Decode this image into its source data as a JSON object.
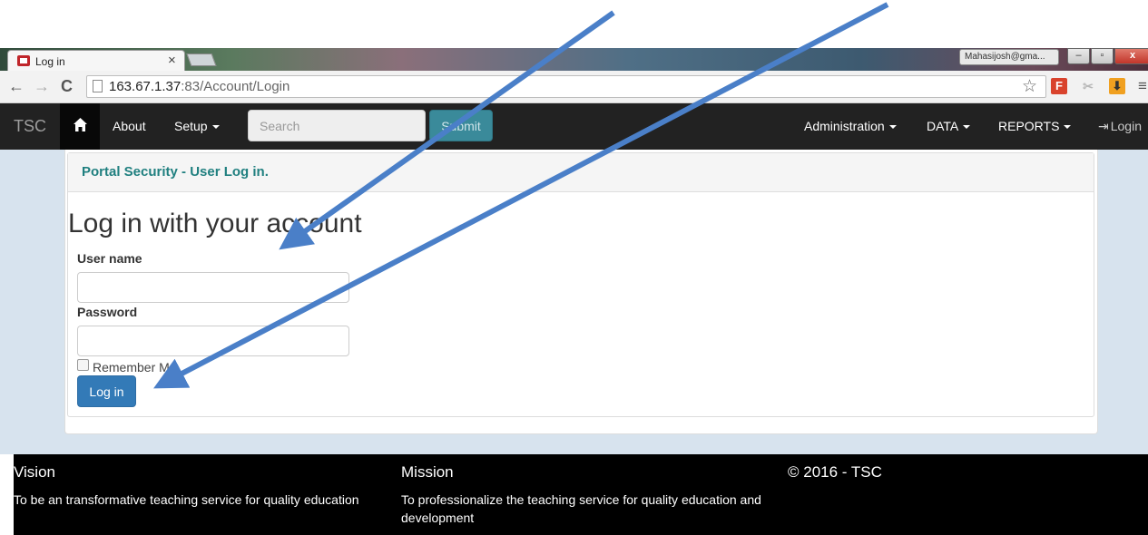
{
  "browser": {
    "tab_title": "Log in",
    "tab_close": "×",
    "url_host": "163.67.1.37",
    "url_path": ":83/Account/Login",
    "profile": "Mahasijosh@gma...",
    "win_min": "–",
    "win_max": "▫",
    "win_close": "x",
    "back": "←",
    "forward": "→",
    "reload": "C",
    "star": "☆",
    "menu": "≡",
    "ext_f": "F"
  },
  "navbar": {
    "brand": "TSC",
    "about": "About",
    "setup": "Setup",
    "search_placeholder": "Search",
    "submit": "Submit",
    "administration": "Administration",
    "data": "DATA",
    "reports": "REPORTS",
    "login": "Login"
  },
  "panel": {
    "title": "Portal Security - User Log in."
  },
  "form": {
    "heading": "Log in with your account",
    "username_label": "User name",
    "username_value": "",
    "password_label": "Password",
    "password_value": "",
    "remember_label": "Remember Me",
    "remember_checked": false,
    "login_button": "Log in"
  },
  "footer": {
    "vision_title": "Vision",
    "vision_text": "To be an transformative teaching service for quality education",
    "mission_title": "Mission",
    "mission_text": "To professionalize the teaching service for quality education and development",
    "copyright": "© 2016 - TSC"
  },
  "colors": {
    "navbar_bg": "#222222",
    "panel_title": "#1f7f7f",
    "primary_button": "#337ab7",
    "arrow": "#4a7fc8"
  }
}
